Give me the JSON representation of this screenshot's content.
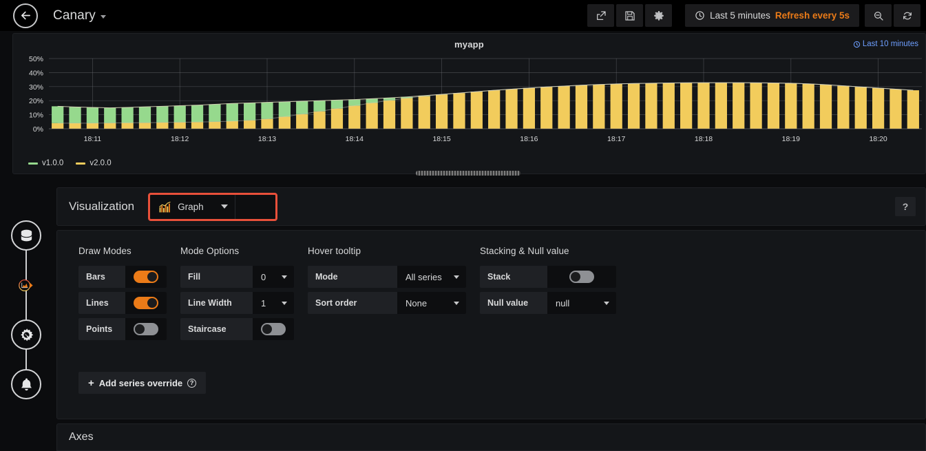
{
  "topnav": {
    "back_icon": "arrow-left-icon",
    "dashboard_title": "Canary",
    "buttons": [
      {
        "name": "share-dashboard-button",
        "icon": "share-icon"
      },
      {
        "name": "save-dashboard-button",
        "icon": "save-floppy-icon"
      },
      {
        "name": "dashboard-settings-button",
        "icon": "gear-icon"
      }
    ],
    "time_picker": {
      "clock_icon": "clock-icon",
      "range": "Last 5 minutes",
      "refresh": "Refresh every 5s"
    },
    "zoom_out_button": {
      "name": "zoom-out-button",
      "icon": "search-minus-icon"
    },
    "refresh_button": {
      "name": "refresh-button",
      "icon": "refresh-icon"
    }
  },
  "panel": {
    "title": "myapp",
    "time_link": "Last 10 minutes",
    "time_link_icon": "clock-icon",
    "time_link_color": "#6e9fff"
  },
  "chart_data": {
    "type": "bar",
    "title": "myapp",
    "xlabel": "",
    "ylabel": "",
    "ylim": [
      0,
      50
    ],
    "ytick_labels": [
      "0%",
      "10%",
      "20%",
      "30%",
      "40%",
      "50%"
    ],
    "yticks": [
      0,
      10,
      20,
      30,
      40,
      50
    ],
    "xtick_labels": [
      "18:11",
      "18:12",
      "18:13",
      "18:14",
      "18:15",
      "18:16",
      "18:17",
      "18:18",
      "18:19",
      "18:20"
    ],
    "grid": true,
    "stacked": true,
    "legend_position": "bottom-left",
    "series": [
      {
        "name": "v1.0.0",
        "color": "#96d98d",
        "values": [
          12.0,
          11.5,
          11.2,
          10.8,
          11.0,
          11.3,
          11.5,
          11.8,
          12.0,
          12.4,
          12.6,
          12.4,
          11.8,
          10.6,
          9.2,
          7.6,
          6.0,
          4.4,
          3.0,
          1.8,
          0.9,
          0.4,
          0.1,
          0.0,
          0.0,
          0.0,
          0.0,
          0.0,
          0.0,
          0.0,
          0.0,
          0.0,
          0.0,
          0.0,
          0.0,
          0.0,
          0.0,
          0.0,
          0.0,
          0.0,
          0.0,
          0.0,
          0.0,
          0.0,
          0.0,
          0.0,
          0.0,
          0.0,
          0.0,
          0.0
        ]
      },
      {
        "name": "v2.0.0",
        "color": "#f2cc5c",
        "values": [
          4.0,
          4.0,
          4.0,
          4.1,
          4.2,
          4.3,
          4.5,
          4.6,
          4.8,
          5.0,
          5.4,
          6.0,
          7.0,
          8.6,
          10.4,
          12.4,
          14.4,
          16.4,
          18.4,
          20.2,
          21.8,
          23.2,
          24.4,
          25.4,
          26.4,
          27.4,
          28.2,
          29.0,
          29.8,
          30.4,
          31.0,
          31.5,
          31.9,
          32.2,
          32.4,
          32.6,
          32.7,
          32.8,
          32.8,
          32.8,
          32.7,
          32.6,
          32.4,
          32.0,
          31.4,
          30.6,
          29.8,
          29.0,
          28.2,
          27.4
        ]
      }
    ],
    "legend": [
      "v1.0.0",
      "v2.0.0"
    ]
  },
  "rail": {
    "items": [
      {
        "name": "sidebar-item-queries",
        "icon": "database-icon",
        "active": false
      },
      {
        "name": "sidebar-item-visualization",
        "icon": "graph-area-icon",
        "active": true
      },
      {
        "name": "sidebar-item-general",
        "icon": "gear-wrench-icon",
        "active": false
      },
      {
        "name": "sidebar-item-alert",
        "icon": "bell-icon",
        "active": false
      }
    ]
  },
  "editor": {
    "visualization_label": "Visualization",
    "visualization_value": "Graph",
    "visualization_icon": "graph-bars-icon",
    "help_button": "?",
    "highlight_color": "#e8503a",
    "accent_color": "#eb7b18",
    "sections": [
      {
        "title": "Draw Modes",
        "rows": [
          {
            "label": "Bars",
            "control": "toggle",
            "value": "on"
          },
          {
            "label": "Lines",
            "control": "toggle",
            "value": "on"
          },
          {
            "label": "Points",
            "control": "toggle",
            "value": "off"
          }
        ]
      },
      {
        "title": "Mode Options",
        "rows": [
          {
            "label": "Fill",
            "control": "select",
            "value": "0"
          },
          {
            "label": "Line Width",
            "control": "select",
            "value": "1"
          },
          {
            "label": "Staircase",
            "control": "toggle",
            "value": "off"
          }
        ]
      },
      {
        "title": "Hover tooltip",
        "rows": [
          {
            "label": "Mode",
            "control": "select",
            "value": "All series"
          },
          {
            "label": "Sort order",
            "control": "select",
            "value": "None"
          }
        ]
      },
      {
        "title": "Stacking & Null value",
        "rows": [
          {
            "label": "Stack",
            "control": "toggle",
            "value": "off"
          },
          {
            "label": "Null value",
            "control": "select",
            "value": "null"
          }
        ]
      }
    ],
    "add_override": {
      "plus": "+",
      "label": "Add series override",
      "help": "?"
    },
    "axes_title": "Axes"
  }
}
